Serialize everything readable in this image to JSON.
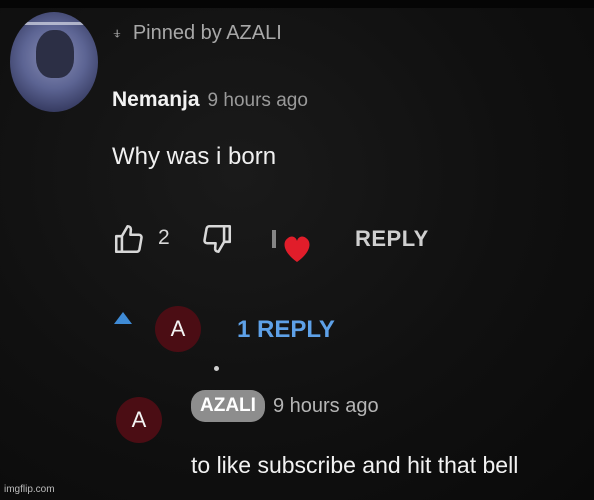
{
  "pinned": {
    "icon": "pin-icon",
    "label": "Pinned by AZALI"
  },
  "comment": {
    "author": "Nemanja",
    "time": "9 hours ago",
    "text": "Why was i born",
    "like_count": "2",
    "reply_label": "REPLY"
  },
  "replies": {
    "toggle_label": "1 REPLY",
    "creator_avatar_letter": "A"
  },
  "reply": {
    "avatar_letter": "A",
    "author_badge": "AZALI",
    "time": "9 hours ago",
    "text": "to like subscribe and hit that bell"
  },
  "watermark": "imgflip.com",
  "colors": {
    "background": "#0b0b0b",
    "link_blue": "#5ea1e8",
    "avatar_red": "#4b0d14",
    "heart_red": "#e11d2a",
    "badge_gray": "#8d8d8d"
  }
}
